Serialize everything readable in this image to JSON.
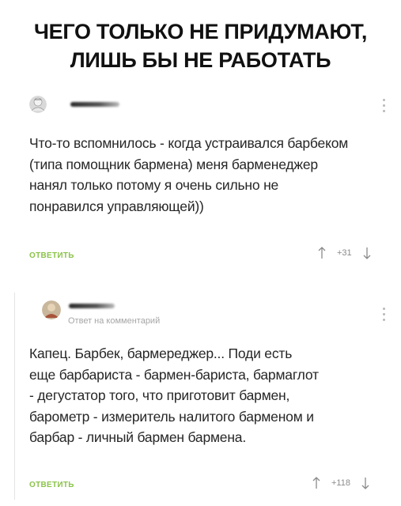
{
  "headline": {
    "line1": "ЧЕГО ТОЛЬКО НЕ ПРИДУМАЮТ,",
    "line2": "ЛИШЬ БЫ НЕ РАБОТАТЬ"
  },
  "comments": [
    {
      "text_lines": [
        "Что-то вспомнилось - когда устраивался барбеком",
        "(типа помощник бармена) меня барменеджер",
        "нанял только потому я очень сильно не",
        "понравился управляющей))"
      ],
      "reply_label": "ОТВЕТИТЬ",
      "rating": "+31",
      "icons": {
        "upvote": "arrow-up-icon",
        "downvote": "arrow-down-icon",
        "menu": "more-vertical-icon"
      }
    },
    {
      "reply_to": "Ответ на комментарий",
      "text_lines": [
        "Капец. Барбек, бармереджер... Поди есть",
        "еще барбариста - бармен-бариста, бармаглот",
        "- дегустатор того, что приготовит бармен,",
        "барометр - измеритель налитого барменом и",
        "барбар - личный бармен бармена."
      ],
      "reply_label": "ОТВЕТИТЬ",
      "rating": "+118",
      "icons": {
        "upvote": "arrow-up-icon",
        "downvote": "arrow-down-icon",
        "menu": "more-vertical-icon"
      }
    }
  ],
  "colors": {
    "reply": "#8bc34a",
    "text": "#262626",
    "muted": "#a6a6a6"
  }
}
